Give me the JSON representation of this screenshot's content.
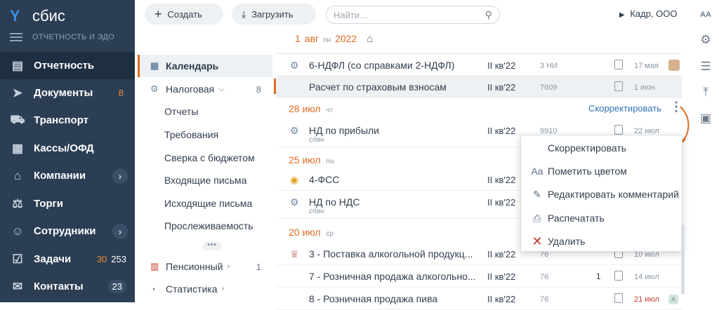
{
  "app": {
    "logo": "сбис",
    "section": "ОТЧЕТНОСТЬ И ЭДО"
  },
  "nav": [
    {
      "label": "Отчетность",
      "icon": "reports-icon"
    },
    {
      "label": "Документы",
      "icon": "documents-icon",
      "count": "8"
    },
    {
      "label": "Транспорт",
      "icon": "truck-icon"
    },
    {
      "label": "Кассы/ОФД",
      "icon": "cashbox-icon"
    },
    {
      "label": "Компании",
      "icon": "companies-icon"
    },
    {
      "label": "Торги",
      "icon": "tenders-icon"
    },
    {
      "label": "Сотрудники",
      "icon": "employees-icon"
    },
    {
      "label": "Задачи",
      "icon": "tasks-icon",
      "count_a": "30",
      "count_b": "253"
    },
    {
      "label": "Контакты",
      "icon": "contacts-icon",
      "count": "23"
    }
  ],
  "toolbar": {
    "create": "Создать",
    "upload": "Загрузить",
    "search_placeholder": "Найти...",
    "org": "Кадр, ООО"
  },
  "datebar": {
    "day": "1",
    "month": "авг",
    "dow": "пн",
    "year": "2022"
  },
  "left_menu": {
    "calendar": "Календарь",
    "tax": "Налоговая",
    "tax_count": "8",
    "subs": [
      "Отчеты",
      "Требования",
      "Сверка с бюджетом",
      "Входящие письма",
      "Исходящие письма",
      "Прослеживаемость"
    ],
    "pension": "Пенсионный",
    "pension_count": "1",
    "stats": "Статистика"
  },
  "rows": [
    {
      "name": "6-НДФЛ (со справками 2-НДФЛ)",
      "period": "II кв'22",
      "code": "3 НИ",
      "date": "17 мая"
    },
    {
      "name": "Расчет по страховым взносам",
      "period": "II кв'22",
      "code": "7609",
      "date": "1 июн"
    },
    {
      "name": "НД по прибыли",
      "period": "II кв'22",
      "code": "9910",
      "date": "22 июл",
      "status": "сдан"
    },
    {
      "name": "4-ФСС",
      "period": "II кв'22"
    },
    {
      "name": "НД по НДС",
      "period": "II кв'22",
      "status": "сдан"
    },
    {
      "name": "3 - Поставка алкогольной продукц...",
      "period": "II кв'22",
      "code": "76"
    },
    {
      "name": "7 - Розничная продажа алкогольно...",
      "period": "II кв'22",
      "code": "76",
      "extra": "1",
      "date": "14 июл"
    },
    {
      "name": "8 - Розничная продажа пива",
      "period": "II кв'22",
      "code": "76",
      "date": "21 июл",
      "avatar": "A"
    }
  ],
  "row5_date": "10 июл",
  "groups": [
    {
      "day": "28",
      "month": "июл",
      "dow": "чт"
    },
    {
      "day": "25",
      "month": "июл",
      "dow": "пн"
    },
    {
      "day": "20",
      "month": "июл",
      "dow": "ср"
    }
  ],
  "correct_link": "Скорректировать",
  "popup": [
    {
      "label": "Скорректировать",
      "icon": ""
    },
    {
      "label": "Пометить цветом",
      "icon": "text-color-icon"
    },
    {
      "label": "Редактировать комментарий",
      "icon": "pencil-icon"
    },
    {
      "label": "Распечатать",
      "icon": "printer-icon"
    },
    {
      "label": "Удалить",
      "icon": "delete-icon"
    }
  ],
  "right_icons": [
    "font-size-icon",
    "gear-icon",
    "list-settings-icon",
    "export-icon",
    "save-icon"
  ],
  "aa_label": "AA",
  "colors": {
    "nav_bg": "#2b3e54",
    "accent": "#e06a23",
    "link": "#2e74b8"
  }
}
